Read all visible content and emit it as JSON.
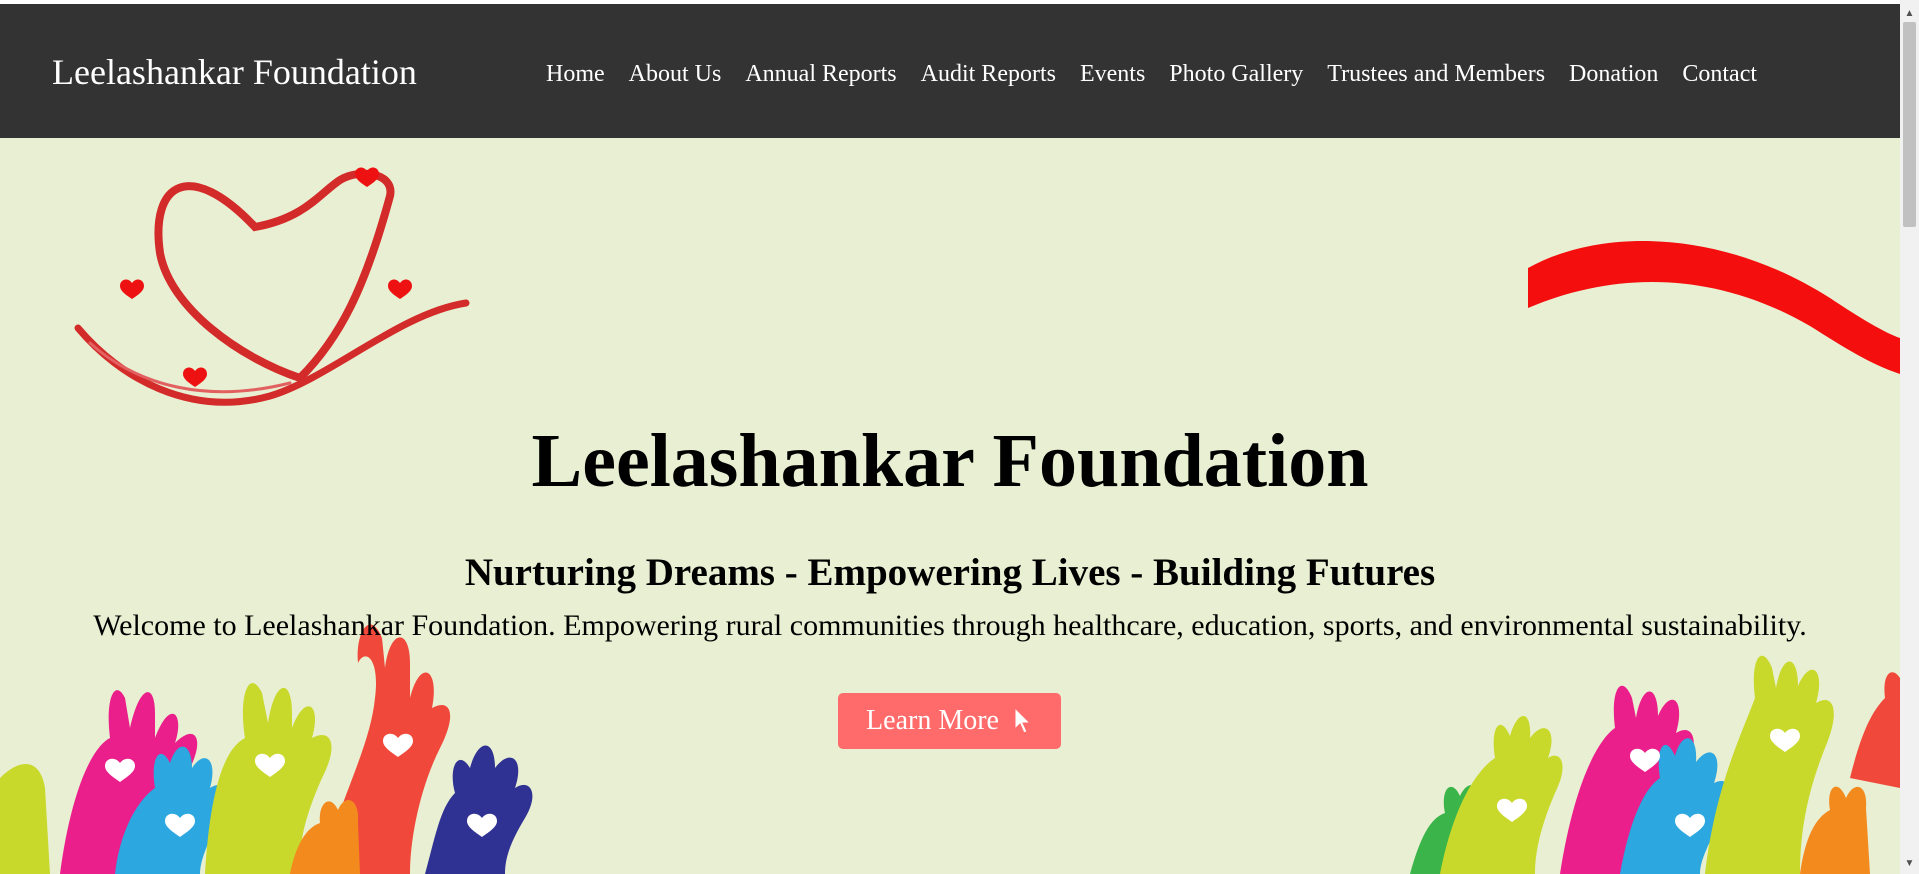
{
  "header": {
    "brand": "Leelashankar Foundation",
    "nav": [
      {
        "label": "Home"
      },
      {
        "label": "About Us"
      },
      {
        "label": "Annual Reports"
      },
      {
        "label": "Audit Reports"
      },
      {
        "label": "Events"
      },
      {
        "label": "Photo Gallery"
      },
      {
        "label": "Trustees and Members"
      },
      {
        "label": "Donation"
      },
      {
        "label": "Contact"
      }
    ]
  },
  "hero": {
    "title": "Leelashankar Foundation",
    "subtitle": "Nurturing Dreams - Empowering Lives - Building Futures",
    "description": "Welcome to Leelashankar Foundation. Empowering rural communities through healthcare, education, sports, and environmental sustainability.",
    "cta_label": "Learn More",
    "cta_icon": "cursor-pointer-icon"
  },
  "colors": {
    "navbar": "#333333",
    "hero_background": "#e9efd2",
    "cta": "#ff6b6b",
    "ribbon": "#d32a2a"
  }
}
